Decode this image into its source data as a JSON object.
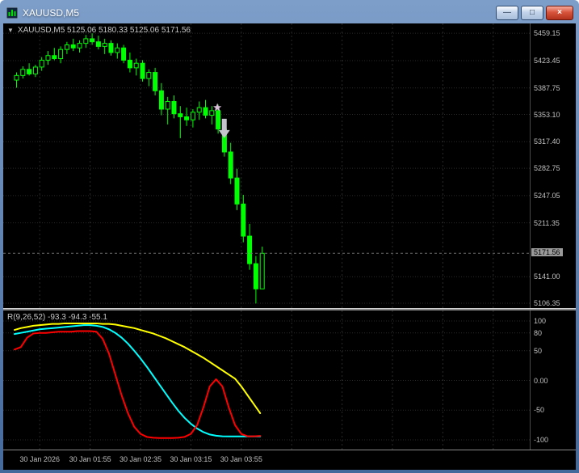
{
  "window": {
    "title": "XAUUSD,M5",
    "controls": {
      "minimize": "—",
      "maximize": "□",
      "close": "×"
    }
  },
  "chart": {
    "dropdown_icon": "▼",
    "ohlc_text": "XAUUSD,M5  5125.06 5180.33 5125.06 5171.56"
  },
  "indicator": {
    "label": "R(9,26,52) -93.3 -94.3 -55.1"
  },
  "colors": {
    "grid": "#2a2a2a",
    "outline": "#00ff00",
    "bull_fill": "#000000",
    "bear_fill": "#00ff00",
    "axis_text": "#c0c0c0",
    "price_line": "#6b6b6b",
    "price_label_bg": "#9a9a9a",
    "annotation": "#c4c4cc",
    "star": "#d8bfd8"
  },
  "chart_data": [
    {
      "type": "candlestick",
      "title": "XAUUSD,M5",
      "symbol": "XAUUSD",
      "timeframe": "M5",
      "last_ohlc": {
        "open": 5125.06,
        "high": 5180.33,
        "low": 5125.06,
        "close": 5171.56
      },
      "current_price": 5171.56,
      "ylim": [
        5100,
        5472
      ],
      "price_ticks": [
        5459.15,
        5423.45,
        5387.75,
        5353.1,
        5317.4,
        5282.75,
        5247.05,
        5211.35,
        5141.0,
        5106.35
      ],
      "time_ticks": [
        {
          "i": 4,
          "label": "30 Jan 2026"
        },
        {
          "i": 12,
          "label": "30 Jan 01:55"
        },
        {
          "i": 20,
          "label": "30 Jan 02:35"
        },
        {
          "i": 28,
          "label": "30 Jan 03:15"
        },
        {
          "i": 36,
          "label": "30 Jan 03:55"
        }
      ],
      "future_gridlines": [
        44,
        52,
        60,
        68,
        76
      ],
      "candles": [
        [
          5398,
          5408,
          5388,
          5404
        ],
        [
          5404,
          5416,
          5400,
          5412
        ],
        [
          5412,
          5420,
          5404,
          5406
        ],
        [
          5406,
          5418,
          5402,
          5415
        ],
        [
          5415,
          5428,
          5410,
          5424
        ],
        [
          5424,
          5436,
          5418,
          5430
        ],
        [
          5430,
          5440,
          5424,
          5426
        ],
        [
          5426,
          5442,
          5420,
          5438
        ],
        [
          5438,
          5448,
          5432,
          5444
        ],
        [
          5444,
          5452,
          5436,
          5440
        ],
        [
          5440,
          5450,
          5434,
          5446
        ],
        [
          5446,
          5457,
          5440,
          5452
        ],
        [
          5452,
          5459,
          5444,
          5448
        ],
        [
          5448,
          5456,
          5438,
          5442
        ],
        [
          5442,
          5452,
          5432,
          5446
        ],
        [
          5446,
          5450,
          5430,
          5434
        ],
        [
          5434,
          5446,
          5426,
          5440
        ],
        [
          5440,
          5444,
          5420,
          5424
        ],
        [
          5424,
          5434,
          5408,
          5414
        ],
        [
          5414,
          5426,
          5404,
          5420
        ],
        [
          5420,
          5424,
          5396,
          5400
        ],
        [
          5400,
          5412,
          5390,
          5408
        ],
        [
          5408,
          5414,
          5378,
          5384
        ],
        [
          5384,
          5394,
          5352,
          5360
        ],
        [
          5360,
          5376,
          5340,
          5370
        ],
        [
          5370,
          5378,
          5348,
          5354
        ],
        [
          5354,
          5364,
          5322,
          5350
        ],
        [
          5350,
          5362,
          5338,
          5346
        ],
        [
          5346,
          5360,
          5336,
          5356
        ],
        [
          5356,
          5370,
          5346,
          5362
        ],
        [
          5362,
          5372,
          5348,
          5352
        ],
        [
          5352,
          5364,
          5340,
          5358
        ],
        [
          5358,
          5366,
          5328,
          5334
        ],
        [
          5334,
          5344,
          5298,
          5304
        ],
        [
          5304,
          5316,
          5262,
          5270
        ],
        [
          5270,
          5282,
          5228,
          5236
        ],
        [
          5236,
          5248,
          5186,
          5194
        ],
        [
          5194,
          5210,
          5150,
          5158
        ],
        [
          5158,
          5168,
          5106,
          5125.06
        ],
        [
          5125.06,
          5180.33,
          5125.06,
          5171.56
        ]
      ],
      "annotations": [
        {
          "type": "star",
          "i": 32.2,
          "price": 5362
        },
        {
          "type": "arrow_down",
          "i": 33.3,
          "price": 5322
        }
      ]
    },
    {
      "type": "line",
      "title": "R(9,26,52)",
      "label": "R(9,26,52) -93.3 -94.3 -55.1",
      "ylim": [
        -100,
        100
      ],
      "ticks": [
        {
          "v": 100,
          "label": "100"
        },
        {
          "v": 80,
          "label": "80"
        },
        {
          "v": 50,
          "label": "50"
        },
        {
          "v": 0,
          "label": "0.00"
        },
        {
          "v": -50,
          "label": "-50"
        },
        {
          "v": -100,
          "label": "-100"
        }
      ],
      "series": [
        {
          "name": "yellow",
          "color": "#ffff00",
          "width": 2,
          "current": -55.1,
          "values": [
            85,
            88,
            90,
            92,
            93,
            94,
            95,
            95,
            96,
            96,
            96,
            96,
            96,
            96,
            95,
            95,
            94,
            92,
            90,
            88,
            85,
            82,
            79,
            75,
            71,
            66,
            61,
            56,
            50,
            44,
            38,
            31,
            24,
            17,
            10,
            3,
            -10,
            -25,
            -40,
            -55.1
          ]
        },
        {
          "name": "cyan",
          "color": "#00ffff",
          "width": 2,
          "current": -94.3,
          "values": [
            78,
            80,
            82,
            84,
            86,
            87,
            88,
            89,
            90,
            91,
            92,
            93,
            93,
            92,
            90,
            86,
            80,
            72,
            62,
            50,
            37,
            23,
            8,
            -7,
            -22,
            -37,
            -51,
            -63,
            -73,
            -81,
            -87,
            -91,
            -93,
            -94,
            -94.3,
            -94.3,
            -94.3,
            -94.3,
            -94.3,
            -94.3
          ]
        },
        {
          "name": "red",
          "color": "#ff0000",
          "width": 2,
          "current": -93.3,
          "values": [
            52,
            56,
            72,
            79,
            80,
            80,
            81,
            82,
            82,
            82,
            83,
            83,
            83,
            82,
            70,
            45,
            10,
            -25,
            -55,
            -78,
            -90,
            -95,
            -96.5,
            -97,
            -97,
            -97,
            -96.5,
            -95,
            -90,
            -75,
            -45,
            -10,
            2,
            -10,
            -45,
            -75,
            -90,
            -94,
            -94,
            -93.3
          ]
        }
      ]
    }
  ]
}
